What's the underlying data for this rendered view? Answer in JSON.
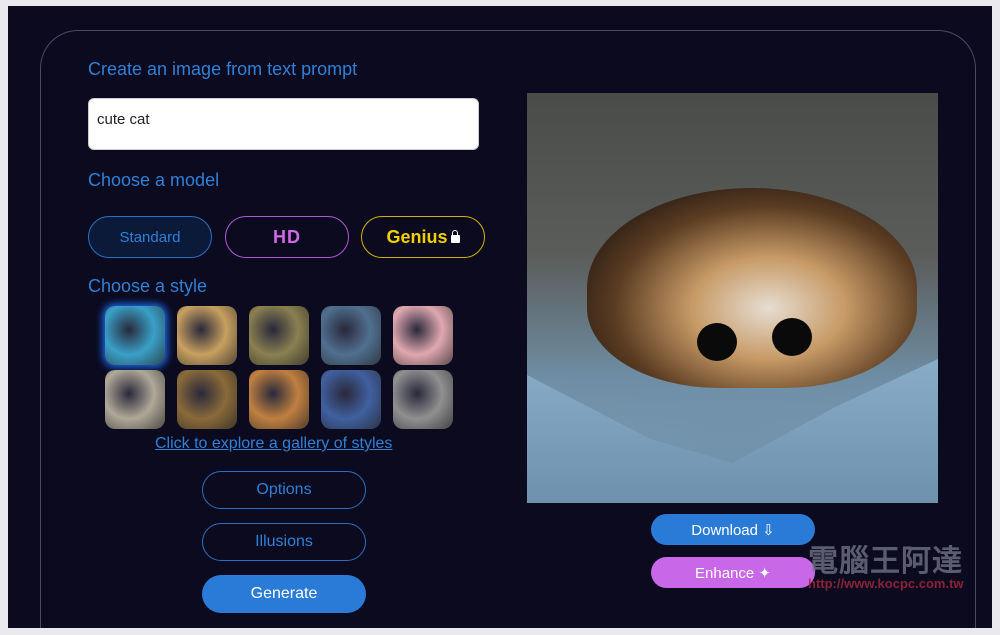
{
  "headings": {
    "prompt": "Create an image from text prompt",
    "model": "Choose a model",
    "style": "Choose a style"
  },
  "prompt": {
    "value": "cute cat"
  },
  "models": [
    {
      "label": "Standard",
      "selected": true
    },
    {
      "label": "HD"
    },
    {
      "label": "Genius",
      "locked": true
    }
  ],
  "styles": [
    {
      "color": "#3aa0c8"
    },
    {
      "color": "#c8a060"
    },
    {
      "color": "#8a8050"
    },
    {
      "color": "#507090"
    },
    {
      "color": "#e0a8b0"
    },
    {
      "color": "#b0a898"
    },
    {
      "color": "#8a6a3a"
    },
    {
      "color": "#c08040"
    },
    {
      "color": "#4060a0"
    },
    {
      "color": "#909090"
    }
  ],
  "gallery_link": "Click to explore a gallery of styles",
  "buttons": {
    "options": "Options",
    "illusions": "Illusions",
    "generate": "Generate",
    "download": "Download ⇩",
    "enhance": "Enhance ✦"
  },
  "watermark": {
    "title": "電腦王阿達",
    "url": "http://www.kocpc.com.tw"
  },
  "colors": {
    "accent": "#2f80d6",
    "hd": "#cf6ae8",
    "genius": "#f0d000",
    "background": "#0b0a1f",
    "enhance": "#c868e8"
  }
}
